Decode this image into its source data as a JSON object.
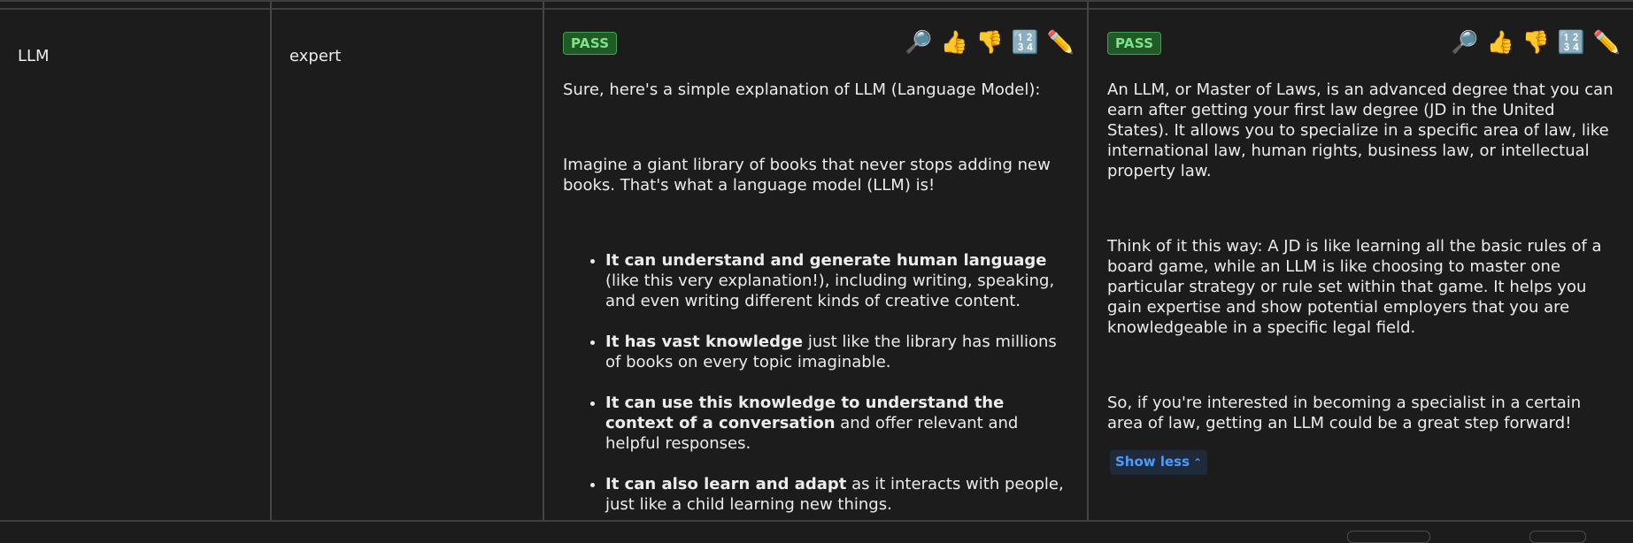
{
  "row": {
    "prompt": "LLM",
    "level": "expert"
  },
  "responses": [
    {
      "status": "PASS",
      "actions": [
        "🔎",
        "👍",
        "👎",
        "🔢",
        "✏️"
      ],
      "paragraphs": [
        "Sure, here's a simple explanation of LLM (Language Model):",
        "Imagine a giant library of books that never stops adding new books. That's what a language model (LLM) is!"
      ],
      "bullets": [
        {
          "bold": "It can understand and generate human language",
          "rest": " (like this very explanation!), including writing, speaking, and even writing different kinds of creative content."
        },
        {
          "bold": "It has vast knowledge",
          "rest": " just like the library has millions of books on every topic imaginable."
        },
        {
          "bold": "It can use this knowledge to understand the context of a conversation",
          "rest": " and offer relevant and helpful responses."
        },
        {
          "bold": "It can also learn and adapt",
          "rest": " as it interacts with people, just like a child learning new things."
        }
      ]
    },
    {
      "status": "PASS",
      "actions": [
        "🔎",
        "👍",
        "👎",
        "🔢",
        "✏️"
      ],
      "paragraphs": [
        "An LLM, or Master of Laws, is an advanced degree that you can earn after getting your first law degree (JD in the United States). It allows you to specialize in a specific area of law, like international law, human rights, business law, or intellectual property law.",
        "Think of it this way: A JD is like learning all the basic rules of a board game, while an LLM is like choosing to master one particular strategy or rule set within that game. It helps you gain expertise and show potential employers that you are knowledgeable in a specific legal field.",
        "So, if you're interested in becoming a specialist in a certain area of law, getting an LLM could be a great step forward!"
      ],
      "show_less_label": "Show less",
      "show_less_icon": "chevron-up-icon"
    }
  ],
  "colors": {
    "background": "#1c1c1c",
    "pass_bg": "#1f5a27",
    "pass_text": "#7fe28a",
    "link": "#4e9bff"
  }
}
